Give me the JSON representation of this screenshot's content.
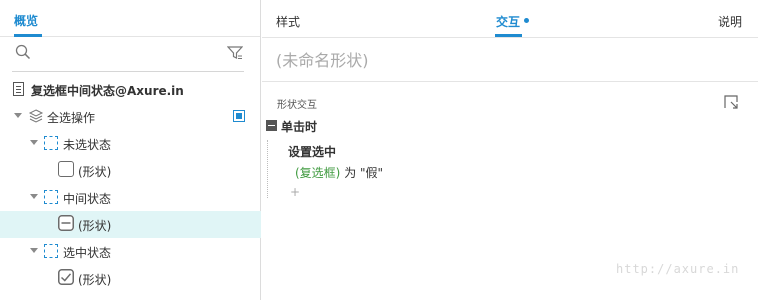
{
  "left_panel": {
    "tab_label": "概览",
    "search": {
      "placeholder": "",
      "value": ""
    },
    "tree": {
      "page": "复选框中间状态@Axure.in",
      "group": "全选操作",
      "states": [
        {
          "label": "未选状态",
          "shape": "(形状)",
          "shape_icon": "checkbox-unchecked-icon"
        },
        {
          "label": "中间状态",
          "shape": "(形状)",
          "shape_icon": "checkbox-indeterminate-icon"
        },
        {
          "label": "选中状态",
          "shape": "(形状)",
          "shape_icon": "checkbox-checked-icon"
        }
      ]
    }
  },
  "right_panel": {
    "tabs": {
      "style": "样式",
      "interaction": "交互",
      "notes": "说明"
    },
    "shape_name_placeholder": "(未命名形状)",
    "section_title": "形状交互",
    "event": "单击时",
    "action": {
      "name": "设置选中",
      "target": "(复选框)",
      "connector": " 为 ",
      "value": "\"假\""
    },
    "add_symbol": "+"
  },
  "watermark": "http://axure.in",
  "colors": {
    "accent": "#1f8bd0",
    "selected_row": "#e0f5f6",
    "target_green": "#3f9a3f"
  }
}
